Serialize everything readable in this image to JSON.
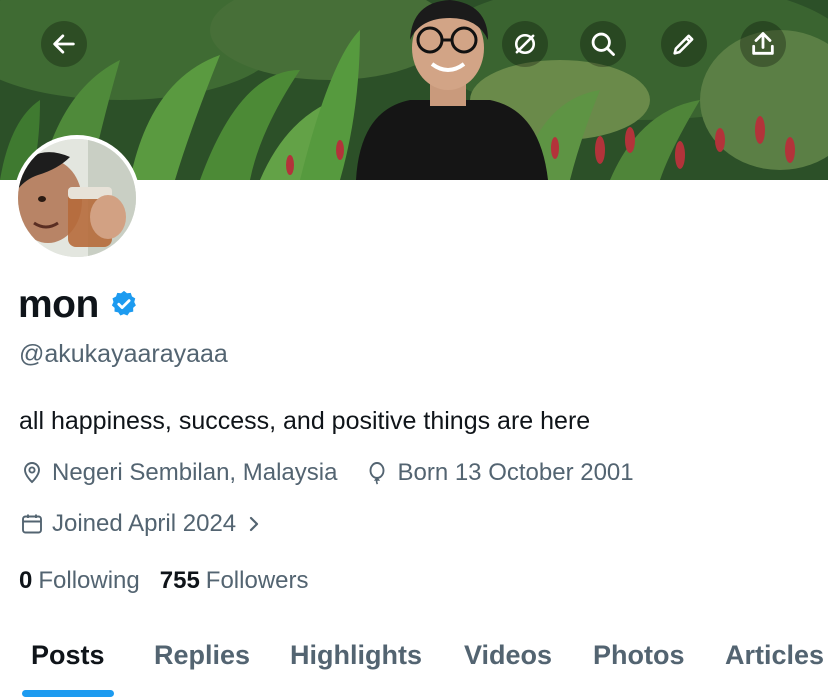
{
  "profile": {
    "name": "mon",
    "handle": "@akukayaarayaaa",
    "bio": "all happiness, success, and positive things are here",
    "location": "Negeri Sembilan, Malaysia",
    "birthday": "Born 13 October 2001",
    "joined": "Joined April 2024",
    "following_count": "0",
    "following_label": "Following",
    "followers_count": "755",
    "followers_label": "Followers",
    "verified": true
  },
  "header_icons": [
    "back-arrow-icon",
    "grok-icon",
    "search-icon",
    "edit-pencil-icon",
    "share-upload-icon"
  ],
  "tabs": [
    {
      "label": "Posts",
      "active": true
    },
    {
      "label": "Replies",
      "active": false
    },
    {
      "label": "Highlights",
      "active": false
    },
    {
      "label": "Videos",
      "active": false
    },
    {
      "label": "Photos",
      "active": false
    },
    {
      "label": "Articles",
      "active": false
    }
  ],
  "colors": {
    "accent": "#1d9bf0",
    "text_primary": "#0f1419",
    "text_secondary": "#536471",
    "verified_badge": "#1d9bf0"
  }
}
